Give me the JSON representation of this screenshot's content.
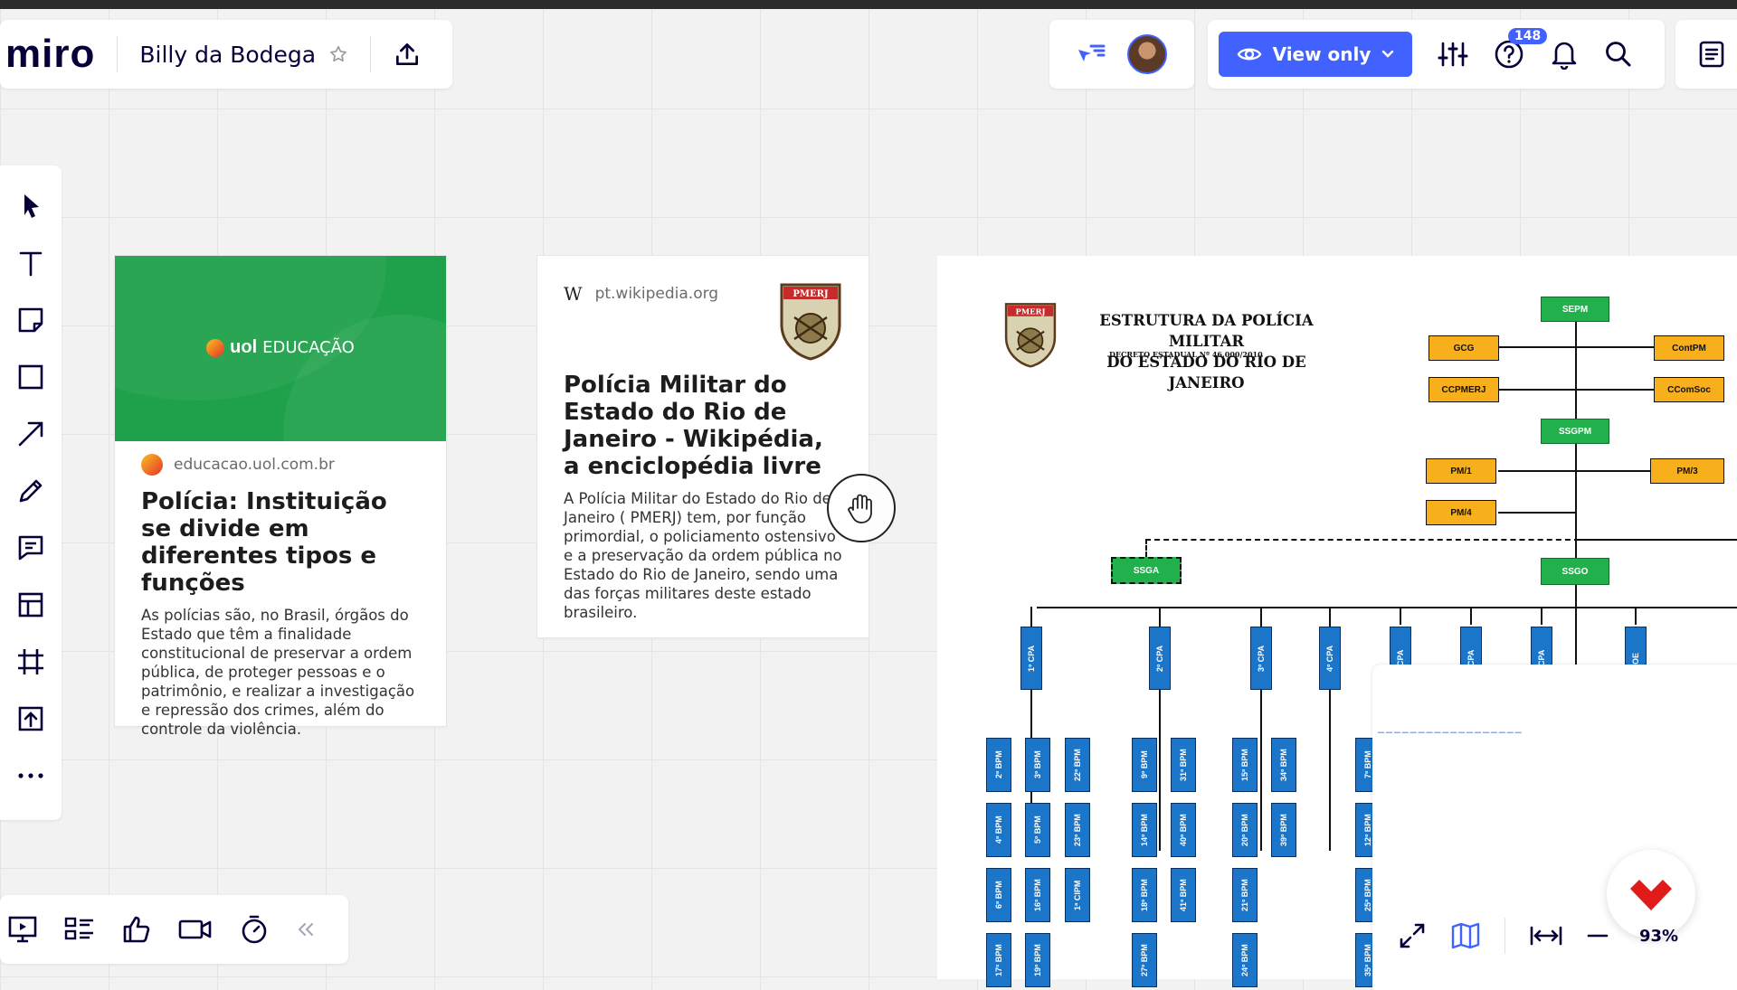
{
  "app": {
    "logo": "miro",
    "board_name": "Billy da Bodega"
  },
  "header": {
    "view_mode_label": "View only",
    "help_badge": "148"
  },
  "cards": [
    {
      "banner_brand_bold": "uol",
      "banner_brand_text": "EDUCAÇÃO",
      "source": "educacao.uol.com.br",
      "title": "Polícia: Instituição se divide em diferentes tipos e funções",
      "description": "As polícias são, no Brasil, órgãos do Estado que têm a finalidade constitucional de preservar a ordem pública, de proteger pessoas e o patrimônio, e realizar a investigação e repressão dos crimes, além do controle da violência."
    },
    {
      "source_logo": "W",
      "source": "pt.wikipedia.org",
      "crest_text": "PMERJ",
      "title": "Polícia Militar do Estado do Rio de Janeiro - Wikipédia, a enciclopédia livre",
      "description": "A Polícia Militar do Estado do Rio de Janeiro ( PMERJ) tem, por função primordial, o policiamento ostensivo e a preservação da ordem pública no Estado do Rio de Janeiro, sendo uma das forças militares deste estado brasileiro."
    }
  ],
  "orgchart": {
    "crest_text": "PMERJ",
    "title_line1": "ESTRUTURA DA POLÍCIA MILITAR",
    "title_line2": "DO ESTADO DO RIO DE JANEIRO",
    "subtitle": "DECRETO ESTADUAL Nº 46.000/2010",
    "boxes": {
      "sepm": "SEPM",
      "gcg": "GCG",
      "contpm": "ContPM",
      "ccpmerj": "CCPMERJ",
      "ccomsoc": "CComSoc",
      "ssgpm": "SSGPM",
      "pm1": "PM/1",
      "pm3": "PM/3",
      "pm4": "PM/4",
      "ssga": "SSGA",
      "ssgo": "SSGO"
    },
    "cpa": [
      "1º CPA",
      "2º CPA",
      "3º CPA",
      "4º CPA",
      "CPA",
      "CPA",
      "CPA",
      "OE"
    ],
    "bpm_columns": [
      [
        "2º BPM",
        "4º BPM",
        "6º BPM",
        "17º BPM"
      ],
      [
        "3º BPM",
        "5º BPM",
        "16º BPM",
        "19º BPM"
      ],
      [
        "22º BPM",
        "23º BPM",
        "1ª CIPM"
      ],
      [
        "9º BPM",
        "14º BPM",
        "18º BPM",
        "27º BPM"
      ],
      [
        "31º BPM",
        "40º BPM",
        "41º BPM"
      ],
      [
        "15º BPM",
        "20º BPM",
        "21º BPM",
        "24º BPM"
      ],
      [
        "34º BPM",
        "39º BPM"
      ],
      [
        "7º BPM",
        "12º BPM",
        "25º BPM",
        "35º BPM"
      ]
    ]
  },
  "zoom": {
    "level": "93%"
  }
}
